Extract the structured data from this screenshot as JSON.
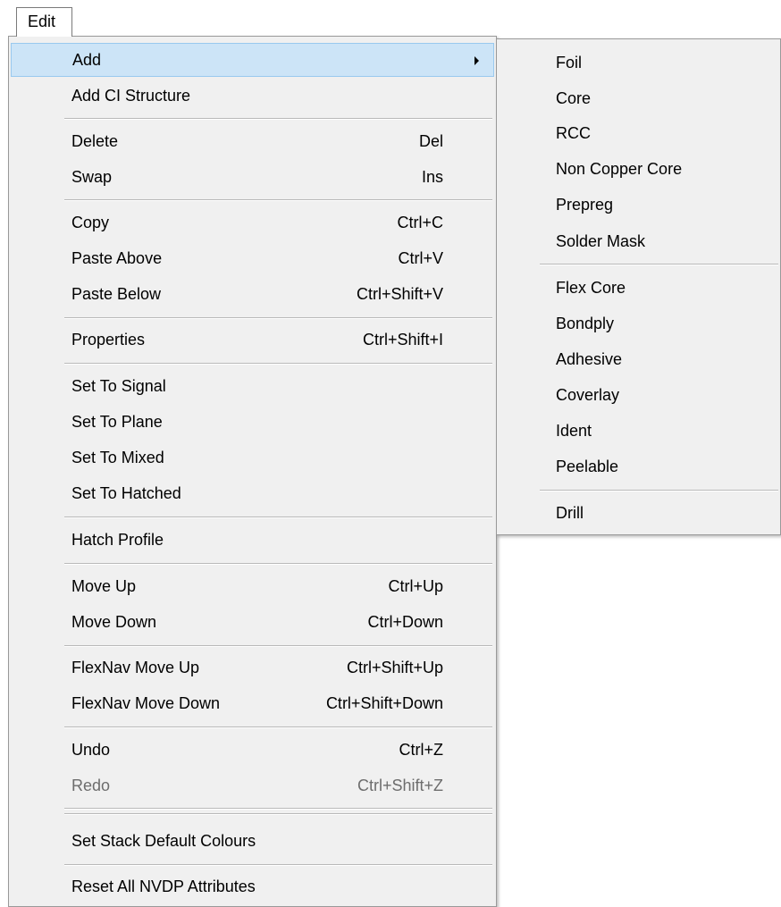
{
  "menubar": {
    "edit_label": "Edit"
  },
  "edit_menu": {
    "items": [
      {
        "label": "Add",
        "shortcut": "",
        "has_submenu": true,
        "highlighted": true
      },
      {
        "label": "Add CI Structure",
        "shortcut": ""
      },
      {
        "label": "Delete",
        "shortcut": "Del"
      },
      {
        "label": "Swap",
        "shortcut": "Ins"
      },
      {
        "label": "Copy",
        "shortcut": "Ctrl+C"
      },
      {
        "label": "Paste Above",
        "shortcut": "Ctrl+V"
      },
      {
        "label": "Paste Below",
        "shortcut": "Ctrl+Shift+V"
      },
      {
        "label": "Properties",
        "shortcut": "Ctrl+Shift+I"
      },
      {
        "label": "Set To Signal",
        "shortcut": ""
      },
      {
        "label": "Set To Plane",
        "shortcut": ""
      },
      {
        "label": "Set To Mixed",
        "shortcut": ""
      },
      {
        "label": "Set To Hatched",
        "shortcut": ""
      },
      {
        "label": "Hatch Profile",
        "shortcut": ""
      },
      {
        "label": "Move Up",
        "shortcut": "Ctrl+Up"
      },
      {
        "label": "Move Down",
        "shortcut": "Ctrl+Down"
      },
      {
        "label": "FlexNav Move Up",
        "shortcut": "Ctrl+Shift+Up"
      },
      {
        "label": "FlexNav Move Down",
        "shortcut": "Ctrl+Shift+Down"
      },
      {
        "label": "Undo",
        "shortcut": "Ctrl+Z"
      },
      {
        "label": "Redo",
        "shortcut": "Ctrl+Shift+Z",
        "disabled": true
      },
      {
        "label": "Set Stack Default Colours",
        "shortcut": ""
      },
      {
        "label": "Reset All NVDP Attributes",
        "shortcut": ""
      }
    ]
  },
  "add_submenu": {
    "items": [
      {
        "label": "Foil"
      },
      {
        "label": "Core"
      },
      {
        "label": "RCC"
      },
      {
        "label": "Non Copper Core"
      },
      {
        "label": "Prepreg"
      },
      {
        "label": "Solder Mask"
      },
      {
        "label": "Flex Core"
      },
      {
        "label": "Bondply"
      },
      {
        "label": "Adhesive"
      },
      {
        "label": "Coverlay"
      },
      {
        "label": "Ident"
      },
      {
        "label": "Peelable"
      },
      {
        "label": "Drill"
      }
    ]
  },
  "colors": {
    "highlight_bg": "#cce4f7",
    "highlight_border": "#99c9ef",
    "menu_bg": "#f0f0f0",
    "disabled_text": "#6d6d6d"
  },
  "icons": {
    "submenu_arrow": "submenu-arrow-icon"
  }
}
